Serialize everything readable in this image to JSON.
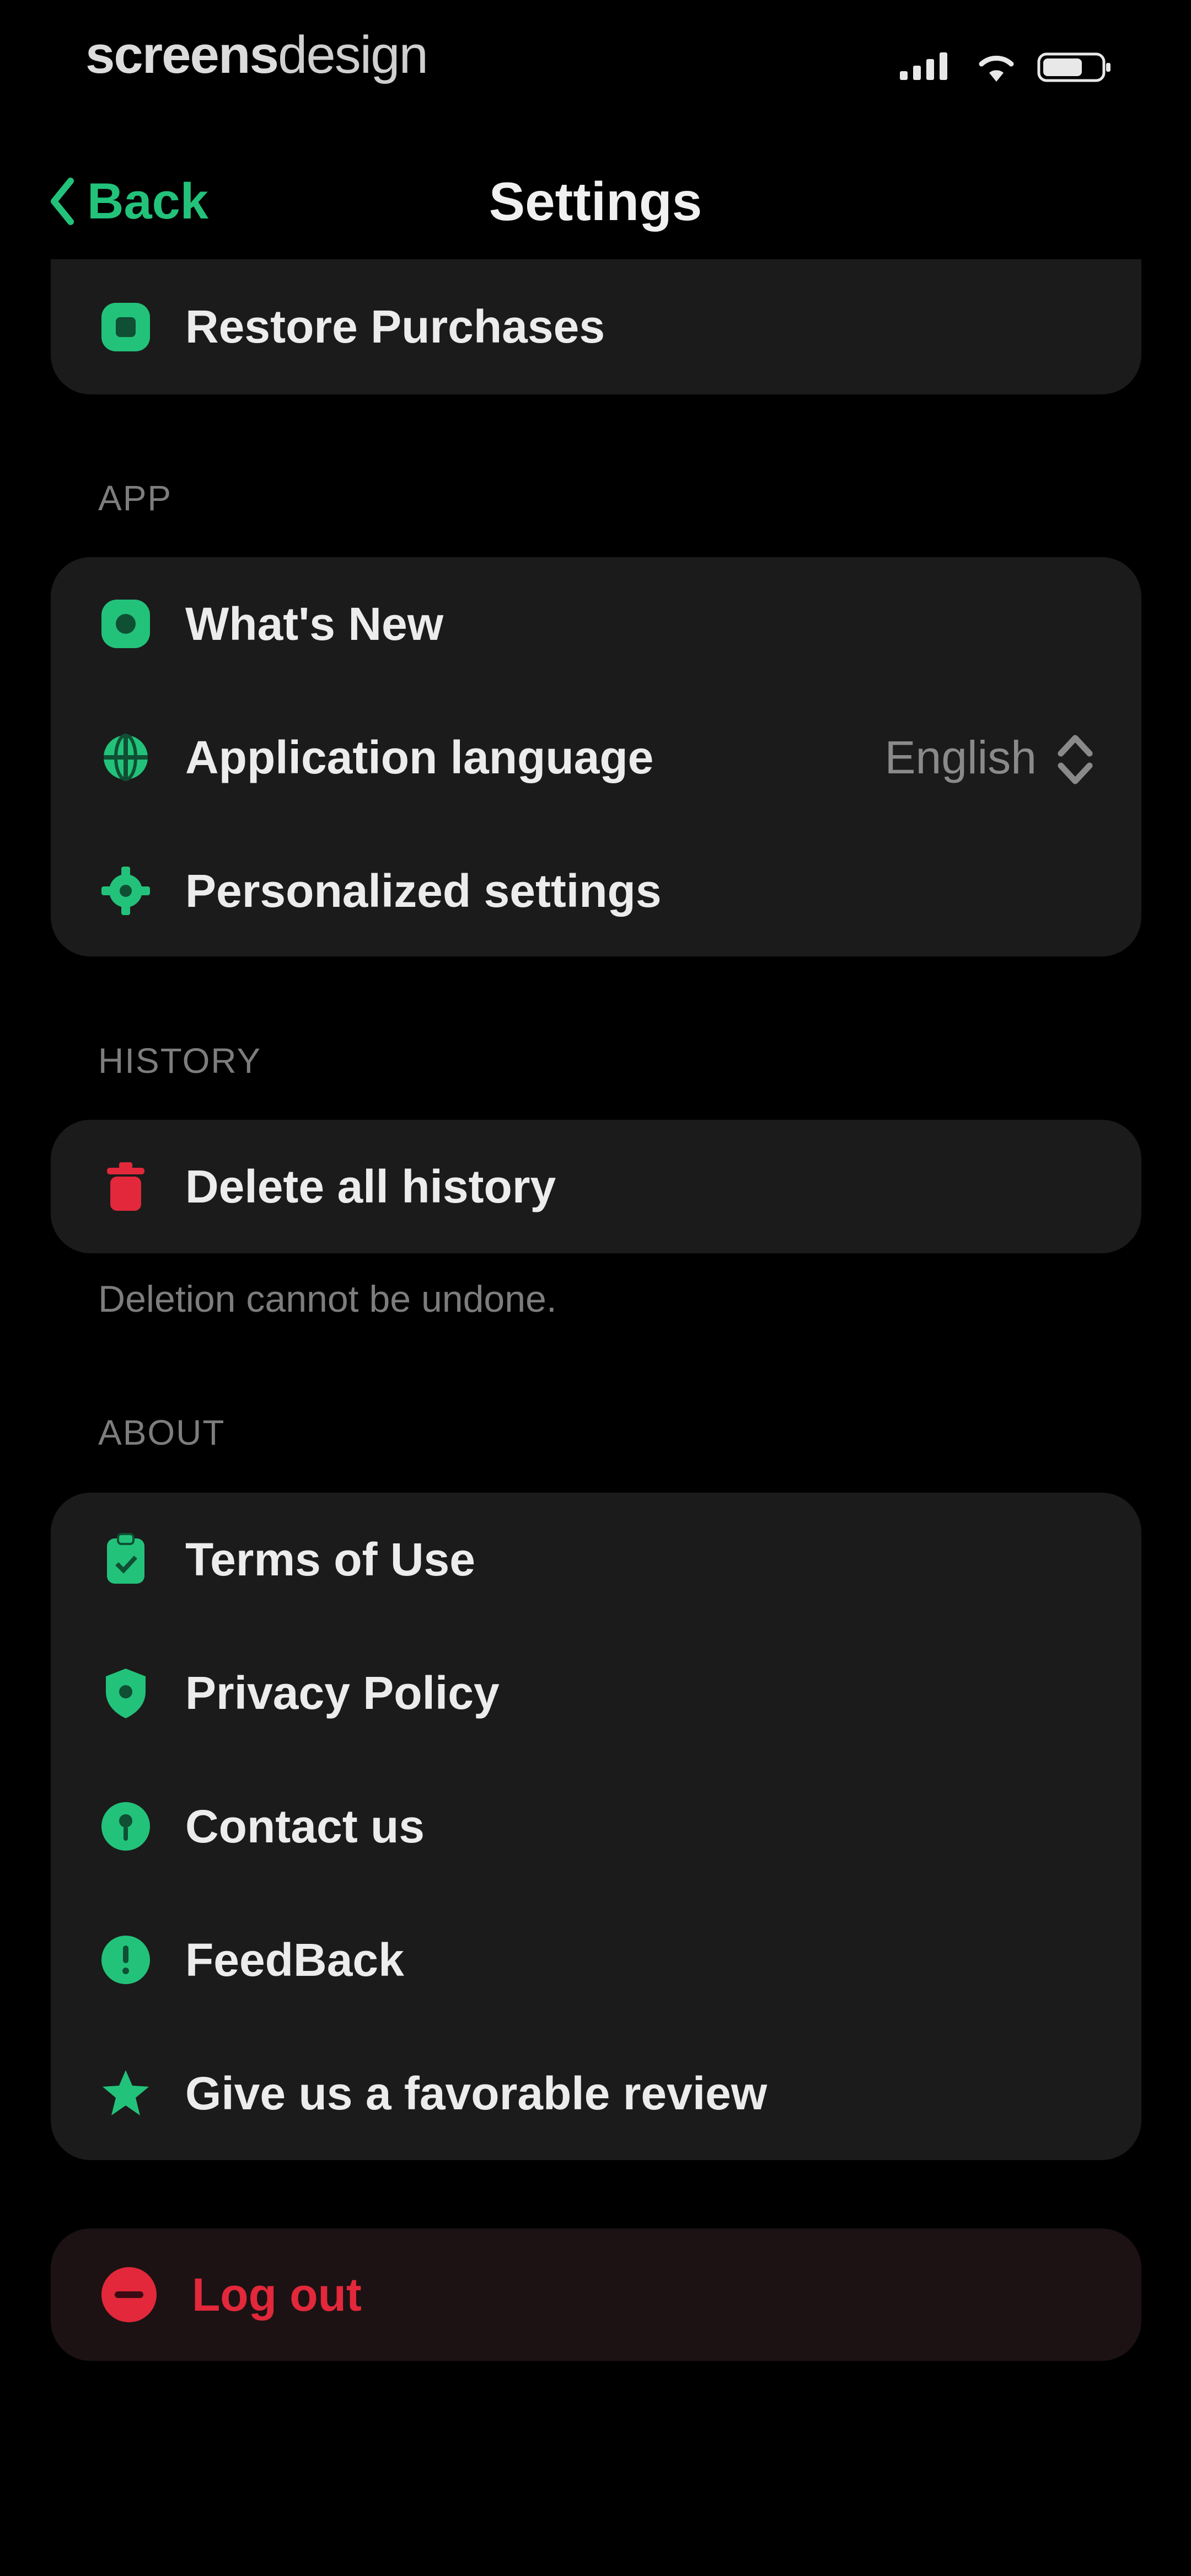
{
  "status_bar": {
    "watermark_bold": "screens",
    "watermark_light": "design"
  },
  "nav": {
    "back_label": "Back",
    "title": "Settings"
  },
  "purchases": {
    "restore_label": "Restore Purchases"
  },
  "app_section": {
    "title": "APP",
    "items": [
      {
        "label": "What's New",
        "icon": "sparkle-badge-icon"
      },
      {
        "label": "Application language",
        "value": "English",
        "icon": "globe-icon"
      },
      {
        "label": "Personalized settings",
        "icon": "gear-icon"
      }
    ]
  },
  "history_section": {
    "title": "HISTORY",
    "delete_label": "Delete all history",
    "note": "Deletion cannot be undone."
  },
  "about_section": {
    "title": "ABOUT",
    "items": [
      {
        "label": "Terms of Use",
        "icon": "clipboard-icon"
      },
      {
        "label": "Privacy Policy",
        "icon": "shield-icon"
      },
      {
        "label": "Contact us",
        "icon": "pin-icon"
      },
      {
        "label": "FeedBack",
        "icon": "info-icon"
      },
      {
        "label": "Give us a favorable review",
        "icon": "star-icon"
      }
    ]
  },
  "logout": {
    "label": "Log out"
  },
  "colors": {
    "accent": "#23c27a",
    "danger": "#e2283a",
    "card": "#1b1b1b",
    "background": "#000000"
  }
}
